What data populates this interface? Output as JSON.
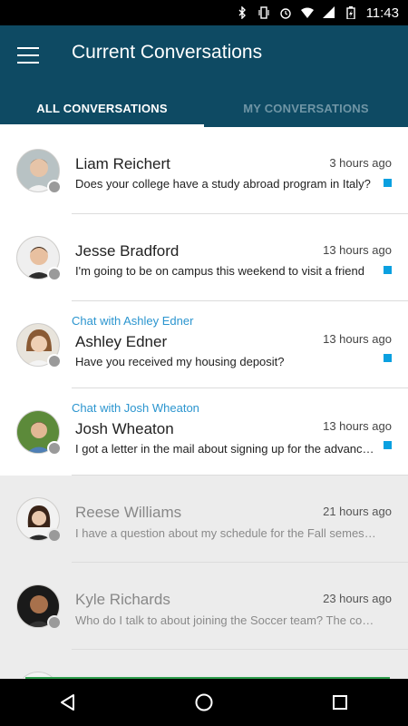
{
  "status_bar": {
    "time": "11:43"
  },
  "app_bar": {
    "title": "Current Conversations"
  },
  "tabs": [
    {
      "label": "ALL CONVERSATIONS",
      "active": true
    },
    {
      "label": "MY CONVERSATIONS",
      "active": false
    }
  ],
  "conversations": [
    {
      "name": "Liam Reichert",
      "chat_with": "",
      "time": "3 hours ago",
      "preview": "Does your college have a study abroad program in Italy?",
      "unread": true
    },
    {
      "name": "Jesse Bradford",
      "chat_with": "",
      "time": "13 hours ago",
      "preview": "I'm going to be on campus this weekend to visit a friend",
      "unread": true
    },
    {
      "name": "Ashley Edner",
      "chat_with": "Chat with Ashley Edner",
      "time": "13 hours ago",
      "preview": "Have you received my housing deposit?",
      "unread": true
    },
    {
      "name": "Josh Wheaton",
      "chat_with": "Chat with Josh Wheaton",
      "time": "13 hours ago",
      "preview": "I got a letter in the mail about signing up for the advanced course",
      "unread": true
    },
    {
      "name": "Reese Williams",
      "chat_with": "",
      "time": "21 hours ago",
      "preview": "I have a question about my schedule for the Fall semester",
      "unread": false
    },
    {
      "name": "Kyle Richards",
      "chat_with": "",
      "time": "23 hours ago",
      "preview": "Who do I talk to about joining the Soccer team? The coach",
      "unread": false
    }
  ],
  "colors": {
    "app_bar": "#0e4a63",
    "unread_indicator": "#0aa0e0",
    "chat_with": "#2b95cf"
  }
}
